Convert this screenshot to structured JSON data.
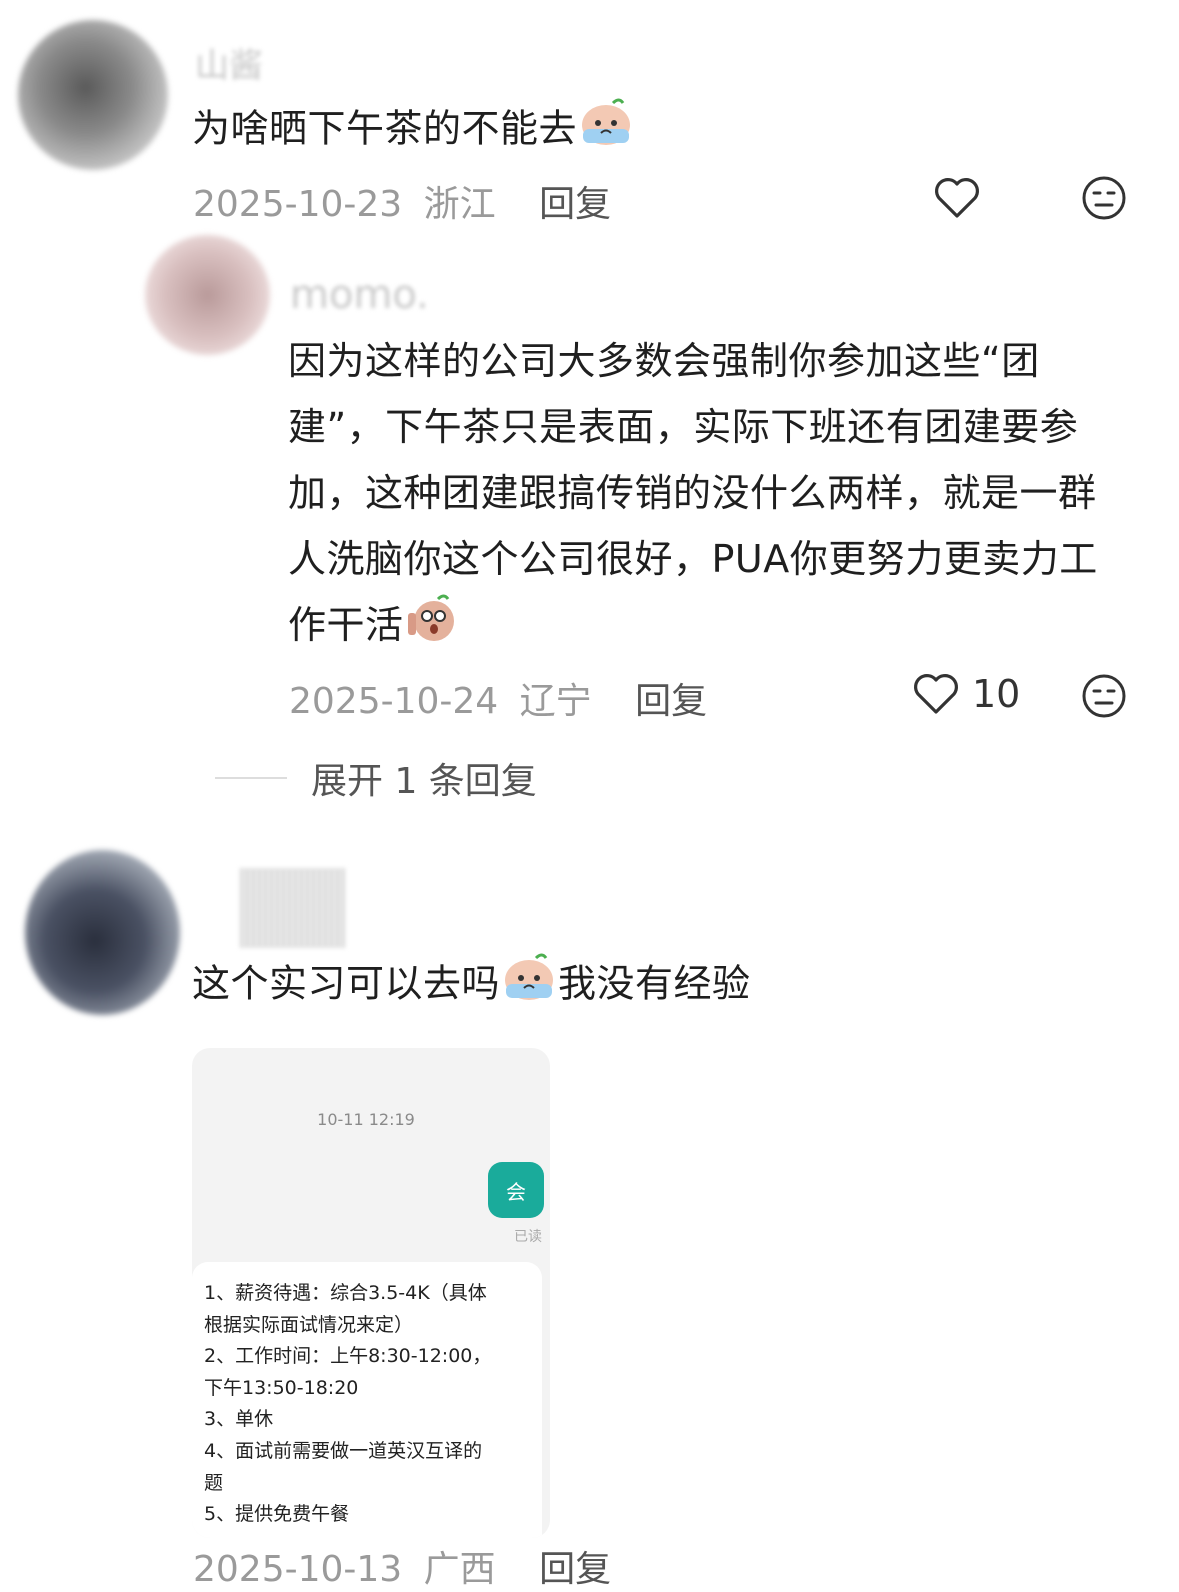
{
  "comments": [
    {
      "username": "山酱",
      "text": "为啥晒下午茶的不能去",
      "date": "2025-10-23",
      "location": "浙江",
      "reply_label": "回复",
      "emoji": "crying-face-emoji"
    },
    {
      "username": "momo.",
      "text": "因为这样的公司大多数会强制你参加这些“团建”，下午茶只是表面，实际下班还有团建要参加，这种团建跟搞传销的没什么两样，就是一群人洗脑你这个公司很好，PUA你更努力更卖力工作干活",
      "date": "2025-10-24",
      "location": "辽宁",
      "reply_label": "回复",
      "likes": "10",
      "emoji": "shocked-face-emoji"
    },
    {
      "username": "",
      "text_before": "这个实习可以去吗",
      "text_after": "我没有经验",
      "date": "2025-10-13",
      "location": "广西",
      "reply_label": "回复",
      "emoji": "crying-face-emoji"
    }
  ],
  "expand_replies": "展开 1 条回复",
  "screenshot": {
    "timestamp": "10-11 12:19",
    "bubble_text": "会",
    "read_status": "已读",
    "lines": [
      "1、薪资待遇：综合3.5-4K（具体",
      "根据实际面试情况来定）",
      "2、工作时间：上午8:30-12:00，",
      "下午13:50-18:20",
      "3、单休",
      "4、面试前需要做一道英汉互译的",
      "题",
      "5、提供免费午餐"
    ]
  },
  "colors": {
    "accent": "#1aab9b",
    "meta": "#9a9a9a",
    "text": "#1f1f1f"
  },
  "icons": [
    "heart-icon",
    "dislike-face-icon"
  ]
}
